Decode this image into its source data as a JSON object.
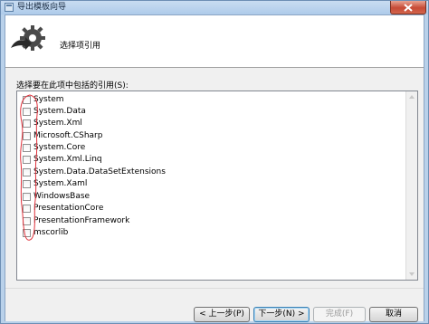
{
  "window": {
    "title": "导出模板向导"
  },
  "header": {
    "title": "选择项引用",
    "icon": "gear-arrow-icon"
  },
  "prompt": "选择要在此项中包括的引用(S):",
  "references": [
    {
      "label": "System",
      "checked": false
    },
    {
      "label": "System.Data",
      "checked": false
    },
    {
      "label": "System.Xml",
      "checked": false
    },
    {
      "label": "Microsoft.CSharp",
      "checked": false
    },
    {
      "label": "System.Core",
      "checked": false
    },
    {
      "label": "System.Xml.Linq",
      "checked": false
    },
    {
      "label": "System.Data.DataSetExtensions",
      "checked": false
    },
    {
      "label": "System.Xaml",
      "checked": false
    },
    {
      "label": "WindowsBase",
      "checked": false
    },
    {
      "label": "PresentationCore",
      "checked": false
    },
    {
      "label": "PresentationFramework",
      "checked": false
    },
    {
      "label": "mscorlib",
      "checked": false
    }
  ],
  "buttons": {
    "back": "< 上一步(P)",
    "next": "下一步(N) >",
    "finish": "完成(F)",
    "cancel": "取消"
  },
  "colors": {
    "annotation": "#e0303a",
    "accent": "#3c7fb1"
  }
}
